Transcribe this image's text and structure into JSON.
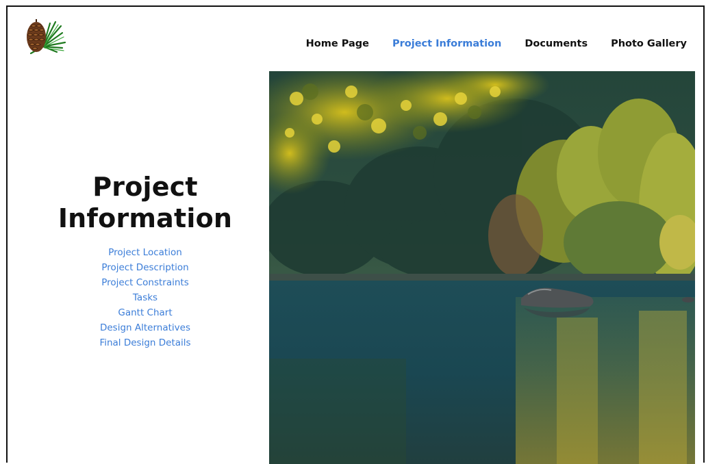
{
  "logo": {
    "icon": "pinecone-icon"
  },
  "nav": {
    "items": [
      {
        "label": "Home Page"
      },
      {
        "label": "Project Information"
      },
      {
        "label": "Documents"
      },
      {
        "label": "Photo Gallery"
      }
    ],
    "active_index": 1,
    "active_color": "#3b7dd8"
  },
  "page": {
    "title_line1": "Project",
    "title_line2": "Information"
  },
  "sections": {
    "links": [
      {
        "label": "Project Location"
      },
      {
        "label": "Project Description"
      },
      {
        "label": "Project Constraints"
      },
      {
        "label": "Tasks"
      },
      {
        "label": "Gantt Chart"
      },
      {
        "label": "Design Alternatives"
      },
      {
        "label": "Final Design Details"
      }
    ],
    "link_color": "#3b7dd8"
  },
  "hero": {
    "icon": "lake-forest-photo"
  }
}
